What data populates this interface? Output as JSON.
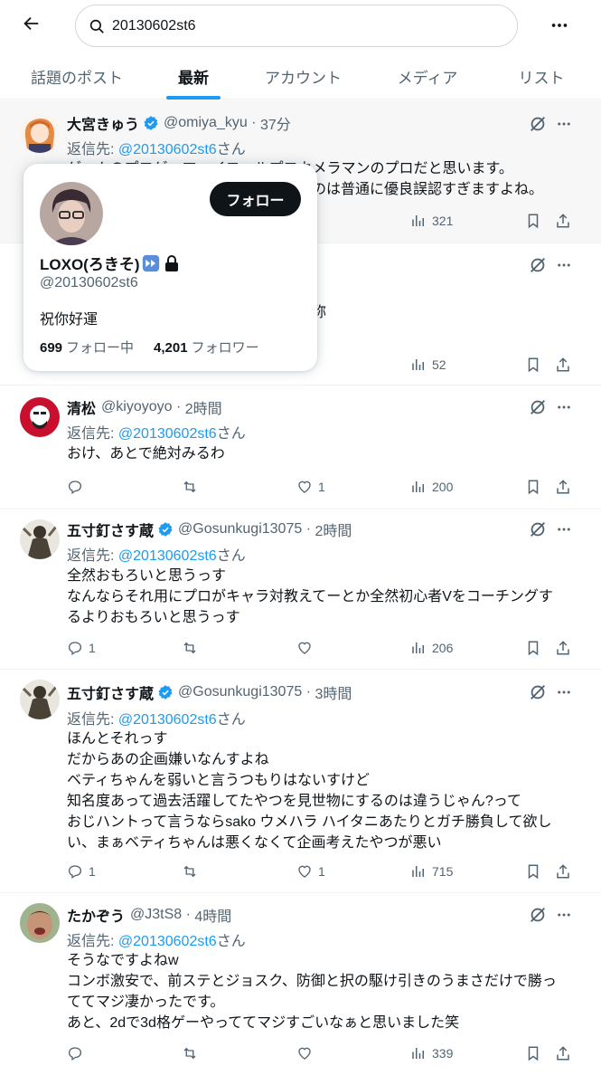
{
  "search": {
    "query": "20130602st6"
  },
  "tabs": [
    {
      "label": "話題のポスト",
      "active": false
    },
    {
      "label": "最新",
      "active": true
    },
    {
      "label": "アカウント",
      "active": false
    },
    {
      "label": "メディア",
      "active": false
    },
    {
      "label": "リスト",
      "active": false
    }
  ],
  "colors": {
    "accent": "#1d9bf0",
    "text": "#0f1419",
    "muted": "#536471"
  },
  "tweets": [
    {
      "name": "大宮きゅう",
      "verified": true,
      "handle": "@omiya_kyu",
      "time": "37分",
      "reply_prefix": "返信先: ",
      "reply_to": "@20130602st6",
      "reply_suffix": "さん",
      "lines": [
        "ゲームのプロゲーマーイコールプロカメラマンのプロだと思います。",
        "プロゲーマーとしてのプロとして見るのは普通に優良誤認すぎますよね。"
      ],
      "replies": "",
      "reposts": "",
      "likes": "",
      "views": "321"
    },
    {
      "name": "",
      "verified": false,
      "handle": "",
      "time": "",
      "reply_prefix": "",
      "reply_to": "",
      "reply_suffix": "",
      "lines": [
        "",
        "称"
      ],
      "replies": "",
      "reposts": "",
      "likes": "",
      "views": "52"
    },
    {
      "name": "清松",
      "verified": false,
      "handle": "@kiyoyoyo",
      "time": "2時間",
      "reply_prefix": "返信先: ",
      "reply_to": "@20130602st6",
      "reply_suffix": "さん",
      "lines": [
        "おけ、あとで絶対みるわ"
      ],
      "replies": "",
      "reposts": "",
      "likes": "1",
      "views": "200"
    },
    {
      "name": "五寸釘さす蔵",
      "verified": true,
      "handle": "@Gosunkugi13075",
      "time": "2時間",
      "reply_prefix": "返信先: ",
      "reply_to": "@20130602st6",
      "reply_suffix": "さん",
      "lines": [
        "全然おもろいと思うっす",
        "なんならそれ用にプロがキャラ対教えてーとか全然初心者Vをコーチングす",
        "るよりおもろいと思うっす"
      ],
      "replies": "1",
      "reposts": "",
      "likes": "",
      "views": "206"
    },
    {
      "name": "五寸釘さす蔵",
      "verified": true,
      "handle": "@Gosunkugi13075",
      "time": "3時間",
      "reply_prefix": "返信先: ",
      "reply_to": "@20130602st6",
      "reply_suffix": "さん",
      "lines": [
        "ほんとそれっす",
        "だからあの企画嫌いなんすよね",
        "ベティちゃんを弱いと言うつもりはないすけど",
        "知名度あって過去活躍してたやつを見世物にするのは違うじゃん?って",
        "おじハントって言うならsako ウメハラ ハイタニあたりとガチ勝負して欲し",
        "い、まぁベティちゃんは悪くなくて企画考えたやつが悪い"
      ],
      "replies": "1",
      "reposts": "",
      "likes": "1",
      "views": "715"
    },
    {
      "name": "たかぞう",
      "verified": false,
      "handle": "@J3tS8",
      "time": "4時間",
      "reply_prefix": "返信先: ",
      "reply_to": "@20130602st6",
      "reply_suffix": "さん",
      "lines": [
        "そうなですよねw",
        "コンボ激安で、前ステとジョスク、防御と択の駆け引きのうまさだけで勝っ",
        "ててマジ凄かったです。",
        "あと、2dで3d格ゲーやっててマジすごいなぁと思いました笑"
      ],
      "replies": "",
      "reposts": "",
      "likes": "",
      "views": "339"
    }
  ],
  "hovercard": {
    "follow_label": "フォロー",
    "name": "LOXO(ろきそ)",
    "handle": "@20130602st6",
    "bio": "祝你好運",
    "following_count": "699",
    "following_label": "フォロー中",
    "followers_count": "4,201",
    "followers_label": "フォロワー"
  }
}
